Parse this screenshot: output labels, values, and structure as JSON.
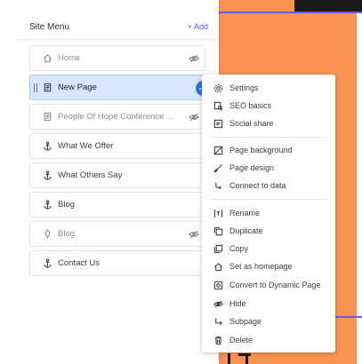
{
  "panel": {
    "title": "Site Menu",
    "add_label": "+ Add"
  },
  "pages": [
    {
      "label": "Home",
      "icon": "home-icon",
      "hidden": true,
      "dim": true
    },
    {
      "label": "New Page",
      "icon": "page-icon",
      "hidden": false,
      "selected": true
    },
    {
      "label": "People Of Hope Conference ...",
      "icon": "page-icon",
      "hidden": true,
      "dim": true
    },
    {
      "label": "What We Offer",
      "icon": "anchor-icon",
      "hidden": false
    },
    {
      "label": "What Others Say",
      "icon": "anchor-icon",
      "hidden": false
    },
    {
      "label": "Blog",
      "icon": "anchor-icon",
      "hidden": false
    },
    {
      "label": "Blog",
      "icon": "pin-icon",
      "hidden": true,
      "dim": true
    },
    {
      "label": "Contact Us",
      "icon": "anchor-icon",
      "hidden": false
    }
  ],
  "context_menu": {
    "items": [
      {
        "label": "Settings",
        "icon": "gear-icon"
      },
      {
        "label": "SEO basics",
        "icon": "seo-icon"
      },
      {
        "label": "Social share",
        "icon": "social-share-icon"
      },
      {
        "label": "Page background",
        "icon": "background-icon"
      },
      {
        "label": "Page design",
        "icon": "brush-icon"
      },
      {
        "label": "Connect to data",
        "icon": "connect-data-icon"
      },
      {
        "label": "Rename",
        "icon": "rename-icon"
      },
      {
        "label": "Duplicate",
        "icon": "duplicate-icon"
      },
      {
        "label": "Copy",
        "icon": "copy-icon"
      },
      {
        "label": "Set as homepage",
        "icon": "home-icon"
      },
      {
        "label": "Convert to Dynamic Page",
        "icon": "dynamic-page-icon"
      },
      {
        "label": "Hide",
        "icon": "hide-icon"
      },
      {
        "label": "Subpage",
        "icon": "subpage-icon"
      },
      {
        "label": "Delete",
        "icon": "trash-icon"
      }
    ]
  },
  "colors": {
    "accent": "#2f6bf3",
    "canvas_background": "#fb9452",
    "selected_row": "#d6e6ff"
  }
}
